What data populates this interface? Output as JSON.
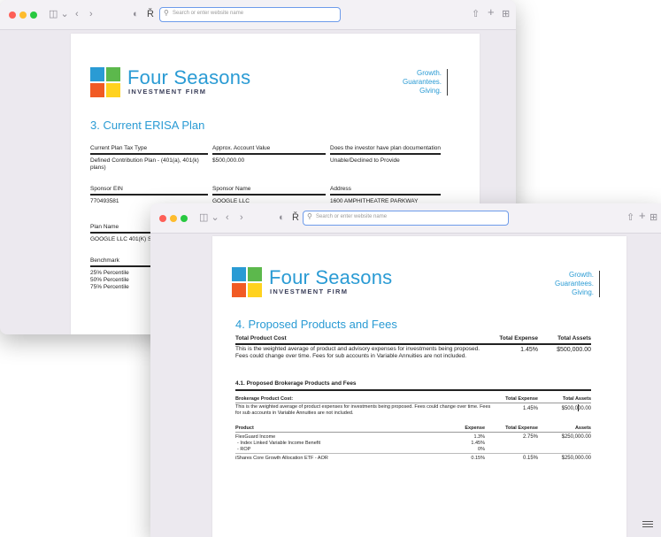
{
  "browser": {
    "url_placeholder": "Search or enter website name",
    "icons": [
      "sidebar-icon",
      "chevron-left-icon",
      "chevron-right-icon",
      "shield-icon",
      "reader-icon",
      "share-icon",
      "new-tab-icon",
      "tab-overview-icon"
    ]
  },
  "brand": {
    "name": "Four Seasons",
    "sub": "INVESTMENT FIRM",
    "tagline": [
      "Growth.",
      "Guarantees.",
      "Giving."
    ],
    "colors": {
      "blue": "#2a9bd4",
      "green": "#5cb84c",
      "orange": "#f15a24",
      "yellow": "#ffd21f"
    }
  },
  "back_doc": {
    "title": "3. Current ERISA Plan",
    "row1": {
      "headers": [
        "Current Plan Tax Type",
        "Approx. Account Value",
        "Does the investor have plan documentation"
      ],
      "values": [
        "Defined Contribution Plan - (401(a), 401(k) plans)",
        "$500,000.00",
        "Unable/Declined to Provide"
      ]
    },
    "row2": {
      "headers": [
        "Sponsor EIN",
        "Sponsor Name",
        "Address"
      ],
      "values": [
        "770493581",
        "GOOGLE LLC",
        "1600 AMPHITHEATRE PARKWAY"
      ]
    },
    "plan_name_header": "Plan Name",
    "plan_name_value": "GOOGLE LLC 401(K) S",
    "benchmark_header": "Benchmark",
    "benchmark_values": [
      "25% Percentile",
      "50% Percentile",
      "75% Percentile"
    ]
  },
  "front_doc": {
    "title": "4. Proposed Products and Fees",
    "total_cost": {
      "header": "Total Product Cost",
      "col_expense": "Total Expense",
      "col_assets": "Total Assets",
      "description": "This is the weighted average of product and advisory expenses for investments being proposed. Fees could change over time. Fees for sub accounts in Variable Annuities are not included.",
      "expense": "1.45%",
      "assets": "$500,000.00"
    },
    "subsection_title": "4.1. Proposed Brokerage Products and Fees",
    "brokerage_cost": {
      "header": "Brokerage Product Cost:",
      "col_expense": "Total Expense",
      "col_assets": "Total Assets",
      "description": "This is the weighted average of product expenses for investments being proposed. Fees could change over time. Fees for sub accounts in Variable Annuities are not included.",
      "expense": "1.45%",
      "assets": "$500,000.00"
    },
    "products_table": {
      "headers": [
        "Product",
        "Expense",
        "Total Expense",
        "Assets"
      ],
      "rows": [
        {
          "product": "FlexGuard Income",
          "expense": "1.3%",
          "total_expense": "2.75%",
          "assets": "$250,000.00",
          "sub": [
            {
              "label": "- Index Linked Variable Income Benefit",
              "expense": "1.45%"
            },
            {
              "label": "- ROP",
              "expense": "0%"
            }
          ]
        },
        {
          "product": "iShares Core Growth Allocation ETF - AOR",
          "expense": "0.15%",
          "total_expense": "0.15%",
          "assets": "$250,000.00",
          "sub": []
        }
      ]
    }
  }
}
